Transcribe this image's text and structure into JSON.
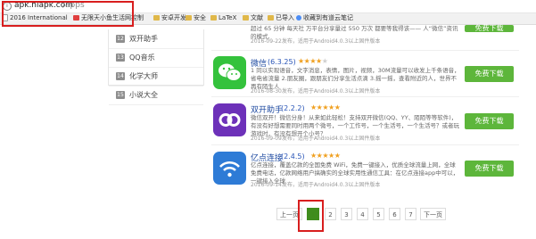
{
  "browser": {
    "url_host": "apk.hiapk.com",
    "url_path": "/apps",
    "bookmarks": [
      {
        "label": "2016 International",
        "icon": "page-icon"
      },
      {
        "label": "无限天小鱼生活网控制",
        "icon": "page-icon"
      },
      {
        "label": "安卓开发",
        "icon": "folder-icon"
      },
      {
        "label": "安全",
        "icon": "folder-icon"
      },
      {
        "label": "LaTeX",
        "icon": "folder-icon"
      },
      {
        "label": "文献",
        "icon": "folder-icon"
      },
      {
        "label": "已导入",
        "icon": "folder-icon"
      },
      {
        "label": "收藏到有道云笔记",
        "icon": "page-icon"
      }
    ]
  },
  "sidebar": {
    "items": [
      {
        "num": "12",
        "label": "双开助手"
      },
      {
        "num": "13",
        "label": "QQ音乐"
      },
      {
        "num": "14",
        "label": "化学大师"
      },
      {
        "num": "15",
        "label": "小说大全"
      }
    ]
  },
  "apps": [
    {
      "name": "",
      "version": "",
      "stars": 0,
      "desc": "超过 65 分钟 每天社 万平台分享量过 550 万次 都要等我得该—— 人“微信”资讯的模式,",
      "date": "2016-09-22发布，适用于Android4.0.3以上固件版本",
      "button": "免费下载"
    },
    {
      "name": "微信",
      "version": "(6.3.25)",
      "stars": 4,
      "desc": "1 同以实现语音，文字消息，表情，图片，视频，30M流量可以收发上千条语音，省电省流量 2.朋友圈，跟朋友们分享生活点滴 3.摇一摇，查看附近的人，世界不再有陌生人",
      "date": "2016-08-30发布，适用于Android4.0.3以上固件版本",
      "button": "免费下载"
    },
    {
      "name": "双开助手",
      "version": "(2.2.2)",
      "stars": 5,
      "desc": "微信双开！微信分身！从来如此轻松！支持双开微信(QQ、YY、陌陌等等软件)，有没有好想需要同时用两个微号，一个工作号，一个生活号，一个生活号？或者玩游戏时，有没有想开个小号？",
      "date": "2016-09-09发布，适用于Android4.0.3以上固件版本",
      "button": "免费下载"
    },
    {
      "name": "亿点连接",
      "version": "(2.4.5)",
      "stars": 5,
      "desc": "亿点连接，覆盖亿款的全国免费 WiFi，免费一键接入，优质全球流量上网，全球免费电话，亿款网络用户搞确实的全球实用性通信工具：在亿点连接app中可以，一键接入全球",
      "date": "2016-09-14发布，适用于Android4.0.3以上固件版本",
      "button": "免费下载"
    }
  ],
  "pagination": {
    "prev": "上一页",
    "pages": [
      "1",
      "2",
      "3",
      "4",
      "5",
      "6",
      "7"
    ],
    "current": "1",
    "next": "下一页"
  },
  "colors": {
    "download_button": "#5db63b",
    "current_page": "#3f8d1d",
    "highlight_box": "#d81e1e",
    "app_name": "#1e4aa0",
    "star": "#f0a020"
  }
}
